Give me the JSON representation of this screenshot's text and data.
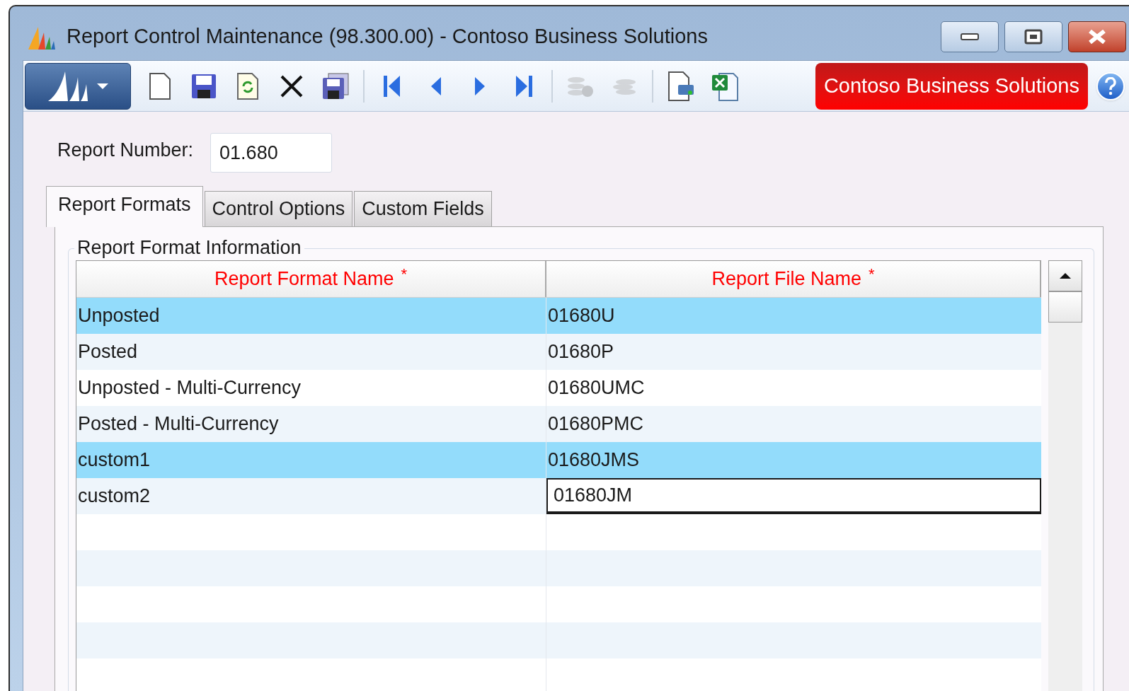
{
  "window": {
    "title": "Report Control Maintenance (98.300.00) - Contoso Business Solutions"
  },
  "toolbar": {
    "items": [
      {
        "kind": "new",
        "disabled": false
      },
      {
        "kind": "save",
        "disabled": false
      },
      {
        "kind": "refresh",
        "disabled": false
      },
      {
        "kind": "delete",
        "disabled": false
      },
      {
        "kind": "saveall",
        "disabled": false
      },
      {
        "kind": "separator"
      },
      {
        "kind": "first",
        "disabled": false
      },
      {
        "kind": "prev",
        "disabled": false
      },
      {
        "kind": "next",
        "disabled": false
      },
      {
        "kind": "last",
        "disabled": false
      },
      {
        "kind": "separator"
      },
      {
        "kind": "dbgear",
        "disabled": true
      },
      {
        "kind": "db",
        "disabled": true
      },
      {
        "kind": "separator"
      },
      {
        "kind": "print",
        "disabled": false
      },
      {
        "kind": "excel",
        "disabled": false
      }
    ],
    "company": "Contoso Business Solutions"
  },
  "report_number": {
    "label": "Report Number:",
    "value": "01.680"
  },
  "tabs": [
    {
      "label": "Report Formats",
      "selected": true
    },
    {
      "label": "Control Options",
      "selected": false
    },
    {
      "label": "Custom Fields",
      "selected": false
    }
  ],
  "group": {
    "title": "Report Format Information"
  },
  "table": {
    "columns": [
      {
        "label": "Report Format Name",
        "required": true
      },
      {
        "label": "Report File Name",
        "required": true
      }
    ],
    "required_mark": "*",
    "rows": [
      {
        "cells": [
          "Unposted",
          "01680U"
        ],
        "selected": true,
        "editing": false
      },
      {
        "cells": [
          "Posted",
          "01680P"
        ],
        "selected": false,
        "editing": false
      },
      {
        "cells": [
          "Unposted - Multi-Currency",
          "01680UMC"
        ],
        "selected": false,
        "editing": false
      },
      {
        "cells": [
          "Posted - Multi-Currency",
          "01680PMC"
        ],
        "selected": false,
        "editing": false
      },
      {
        "cells": [
          "custom1",
          "01680JMS"
        ],
        "selected": true,
        "editing": false
      },
      {
        "cells": [
          "custom2",
          "01680JM"
        ],
        "selected": false,
        "editing": true
      }
    ]
  }
}
